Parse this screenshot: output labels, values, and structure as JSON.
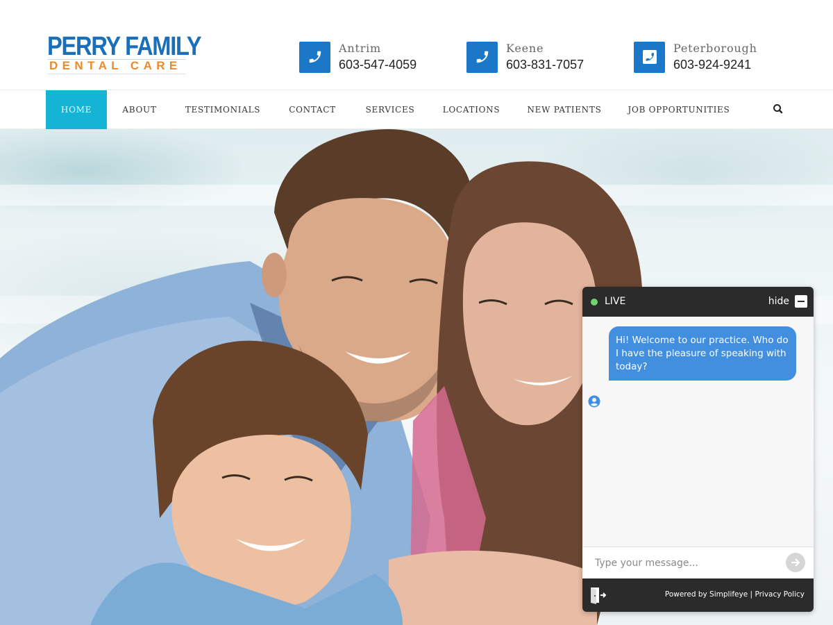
{
  "page": {
    "stray_char": "?"
  },
  "header": {
    "logo": {
      "line1": "PERRY FAMILY",
      "line2": "DENTAL CARE"
    },
    "locations": [
      {
        "name": "Antrim",
        "phone": "603-547-4059",
        "icon": "phone-icon"
      },
      {
        "name": "Keene",
        "phone": "603-831-7057",
        "icon": "phone-icon"
      },
      {
        "name": "Peterborough",
        "phone": "603-924-9241",
        "icon": "phone-square-icon"
      }
    ]
  },
  "nav": {
    "items": [
      {
        "label": "HOME",
        "active": true
      },
      {
        "label": "ABOUT"
      },
      {
        "label": "TESTIMONIALS"
      },
      {
        "label": "CONTACT"
      },
      {
        "label": "SERVICES"
      },
      {
        "label": "LOCATIONS"
      },
      {
        "label": "NEW PATIENTS"
      },
      {
        "label": "JOB OPPORTUNITIES"
      }
    ],
    "search_icon": "search-icon"
  },
  "hero": {
    "description": "Smiling family: father, mother and young son"
  },
  "chat": {
    "status": "LIVE",
    "hide_label": "hide",
    "messages": [
      {
        "from": "agent",
        "text": "Hi! Welcome to our practice.  Who do I have the pleasure of speaking with today?"
      }
    ],
    "input_placeholder": "Type your message...",
    "input_value": "",
    "powered_by": "Powered by Simplifeye",
    "separator": "|",
    "privacy_label": "Privacy Policy"
  },
  "colors": {
    "brand_blue": "#1a6fba",
    "brand_orange": "#e98a2b",
    "icon_blue": "#1b78c8",
    "nav_active": "#13b4d4",
    "chat_dark": "#2b2b2b",
    "chat_bubble": "#428fe0",
    "live_green": "#6dd66b"
  }
}
